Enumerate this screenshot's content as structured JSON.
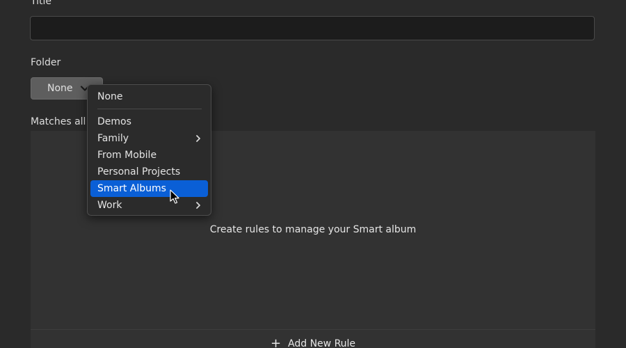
{
  "form": {
    "title_label": "Title",
    "title_value": "",
    "folder_label": "Folder",
    "folder_selected": "None",
    "matches_label": "Matches all c"
  },
  "folder_menu": {
    "items": [
      {
        "label": "None",
        "submenu": false,
        "selected": false
      },
      {
        "label": "Demos",
        "submenu": false,
        "selected": false
      },
      {
        "label": "Family",
        "submenu": true,
        "selected": false
      },
      {
        "label": "From Mobile",
        "submenu": false,
        "selected": false
      },
      {
        "label": "Personal Projects",
        "submenu": false,
        "selected": false
      },
      {
        "label": "Smart Albums",
        "submenu": false,
        "selected": true
      },
      {
        "label": "Work",
        "submenu": true,
        "selected": false
      }
    ]
  },
  "rules": {
    "empty_text": "Create rules to manage your Smart album",
    "add_rule_label": "Add New Rule",
    "add_rule_icon": "plus-icon"
  },
  "colors": {
    "background": "#2a2a2a",
    "panel": "#323232",
    "menu_highlight": "#0a5fd6"
  }
}
